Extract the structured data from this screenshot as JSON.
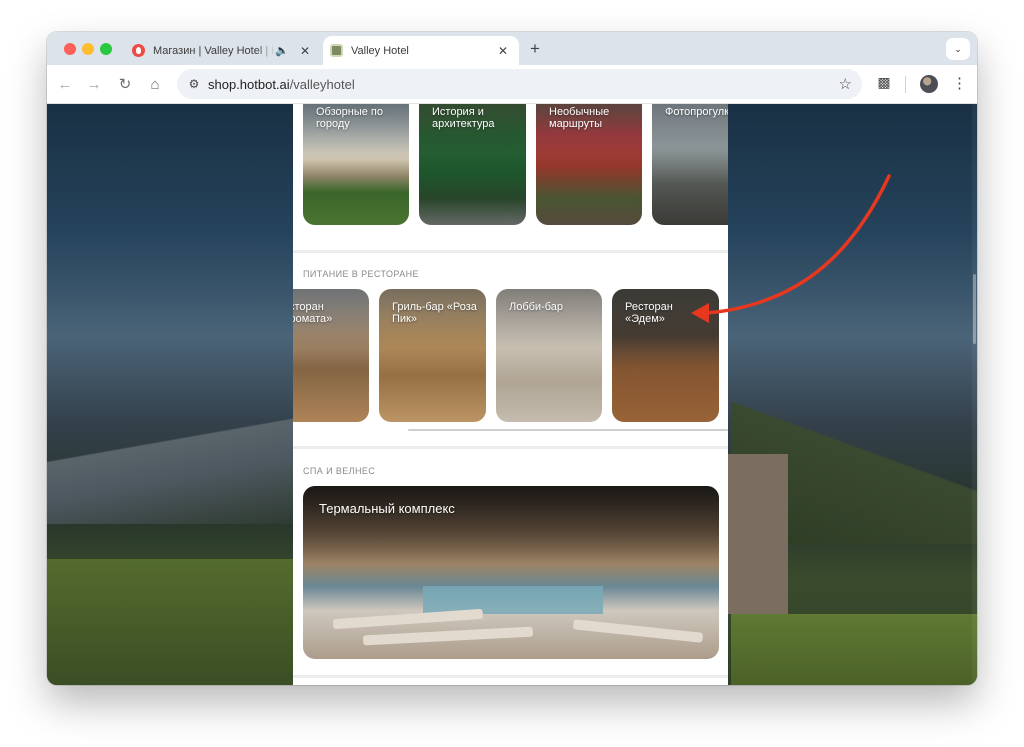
{
  "browser": {
    "tabs": [
      {
        "title": "Магазин | Valley Hotel | Н",
        "active": false,
        "audio": true
      },
      {
        "title": "Valley Hotel",
        "active": true
      }
    ],
    "new_tab_glyph": "+",
    "url": {
      "host": "shop.hotbot.ai",
      "path": "/valleyhotel"
    }
  },
  "page": {
    "excursions": [
      {
        "label": "Обзорные по городу"
      },
      {
        "label": "История и архитектура"
      },
      {
        "label": "Необычные маршруты"
      },
      {
        "label": "Фотопрогулки"
      }
    ],
    "dining": {
      "title": "ПИТАНИЕ В РЕСТОРАНЕ",
      "items": [
        {
          "label": "Ресторан «Аромата»"
        },
        {
          "label": "Гриль-бар «Роза Пик»"
        },
        {
          "label": "Лобби-бар"
        },
        {
          "label": "Ресторан «Эдем»"
        }
      ]
    },
    "spa": {
      "title": "СПА И ВЕЛНЕС",
      "items": [
        {
          "label": "Термальный комплекс"
        }
      ]
    }
  },
  "colors": {
    "annotation_arrow": "#e8371f",
    "tab_strip": "#dde3ea",
    "section_title": "#8a8a8a"
  },
  "icons": [
    "close-icon",
    "audio-icon",
    "plus-icon",
    "back-icon",
    "forward-icon",
    "reload-icon",
    "home-icon",
    "site-info-icon",
    "star-icon",
    "extensions-icon",
    "profile-avatar",
    "menu-icon",
    "tab-search-icon"
  ]
}
